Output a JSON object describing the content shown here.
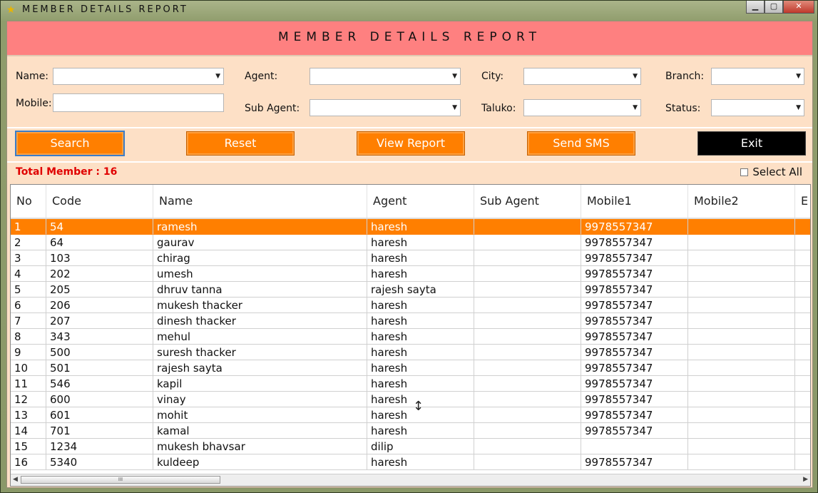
{
  "window": {
    "title": "MEMBER DETAILS REPORT",
    "icon": "star-app-icon",
    "minimize": "▁",
    "maximize": "▢",
    "close": "✕"
  },
  "header": {
    "title": "MEMBER DETAILS REPORT"
  },
  "filters": {
    "name_label": "Name:",
    "mobile_label": "Mobile:",
    "agent_label": "Agent:",
    "sub_agent_label": "Sub Agent:",
    "city_label": "City:",
    "taluko_label": "Taluko:",
    "branch_label": "Branch:",
    "status_label": "Status:",
    "name_value": "",
    "mobile_value": "",
    "agent_value": "",
    "sub_agent_value": "",
    "city_value": "",
    "taluko_value": "",
    "branch_value": "",
    "status_value": ""
  },
  "buttons": {
    "search": "Search",
    "reset": "Reset",
    "view_report": "View Report",
    "send_sms": "Send SMS",
    "exit": "Exit"
  },
  "summary": {
    "total": "Total Member : 16",
    "select_all": "Select All"
  },
  "table": {
    "columns": [
      "No",
      "Code",
      "Name",
      "Agent",
      "Sub Agent",
      "Mobile1",
      "Mobile2",
      "E"
    ],
    "rows": [
      [
        "1",
        "54",
        "ramesh",
        "haresh",
        "",
        "9978557347",
        ""
      ],
      [
        "2",
        "64",
        "gaurav",
        "haresh",
        "",
        "9978557347",
        ""
      ],
      [
        "3",
        "103",
        "chirag",
        "haresh",
        "",
        "9978557347",
        ""
      ],
      [
        "4",
        "202",
        "umesh",
        "haresh",
        "",
        "9978557347",
        ""
      ],
      [
        "5",
        "205",
        "dhruv tanna",
        "rajesh sayta",
        "",
        "9978557347",
        ""
      ],
      [
        "6",
        "206",
        "mukesh thacker",
        "haresh",
        "",
        "9978557347",
        ""
      ],
      [
        "7",
        "207",
        "dinesh thacker",
        "haresh",
        "",
        "9978557347",
        ""
      ],
      [
        "8",
        "343",
        "mehul",
        "haresh",
        "",
        "9978557347",
        ""
      ],
      [
        "9",
        "500",
        "suresh thacker",
        "haresh",
        "",
        "9978557347",
        ""
      ],
      [
        "10",
        "501",
        "rajesh sayta",
        "haresh",
        "",
        "9978557347",
        ""
      ],
      [
        "11",
        "546",
        "kapil",
        "haresh",
        "",
        "9978557347",
        ""
      ],
      [
        "12",
        "600",
        "vinay",
        "haresh",
        "",
        "9978557347",
        ""
      ],
      [
        "13",
        "601",
        "mohit",
        "haresh",
        "",
        "9978557347",
        ""
      ],
      [
        "14",
        "701",
        "kamal",
        "haresh",
        "",
        "9978557347",
        ""
      ],
      [
        "15",
        "1234",
        "mukesh bhavsar",
        "dilip",
        "",
        "",
        ""
      ],
      [
        "16",
        "5340",
        "kuldeep",
        "haresh",
        "",
        "9978557347",
        ""
      ]
    ],
    "selected_row": 0
  },
  "scrollbar": {
    "thumb_grip": "III"
  },
  "colors": {
    "header": "#fe8080",
    "panel": "#fde0c6",
    "accent": "#ff7f00",
    "total_text": "#e00000"
  }
}
